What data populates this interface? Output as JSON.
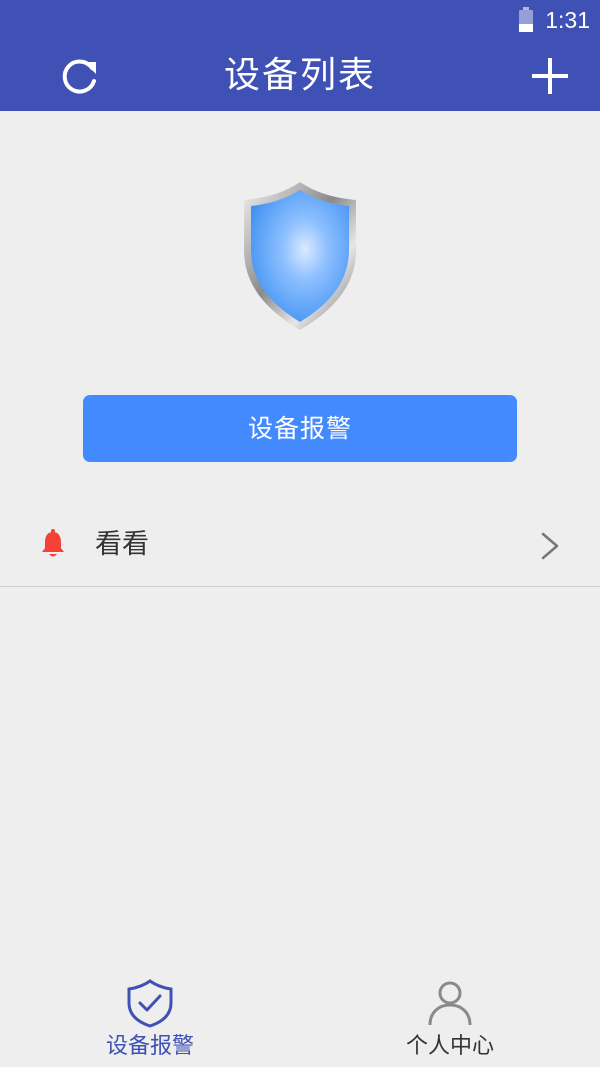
{
  "status_bar": {
    "time": "1:31",
    "battery_icon": "battery-icon"
  },
  "app_bar": {
    "title": "设备列表",
    "refresh_icon": "refresh-icon",
    "add_icon": "plus-icon"
  },
  "hero": {
    "icon": "shield-icon"
  },
  "alarm_button": {
    "label": "设备报警"
  },
  "device_list": [
    {
      "name": "看看",
      "icon": "bell-icon",
      "trailing_icon": "chevron-right-icon"
    }
  ],
  "bottom_nav": {
    "items": [
      {
        "label": "设备报警",
        "icon": "shield-check-icon",
        "active": true
      },
      {
        "label": "个人中心",
        "icon": "user-icon",
        "active": false
      }
    ]
  },
  "colors": {
    "primary": "#3f51b5",
    "button": "#448aff",
    "background": "#eeeeee",
    "bell": "#f44336"
  }
}
